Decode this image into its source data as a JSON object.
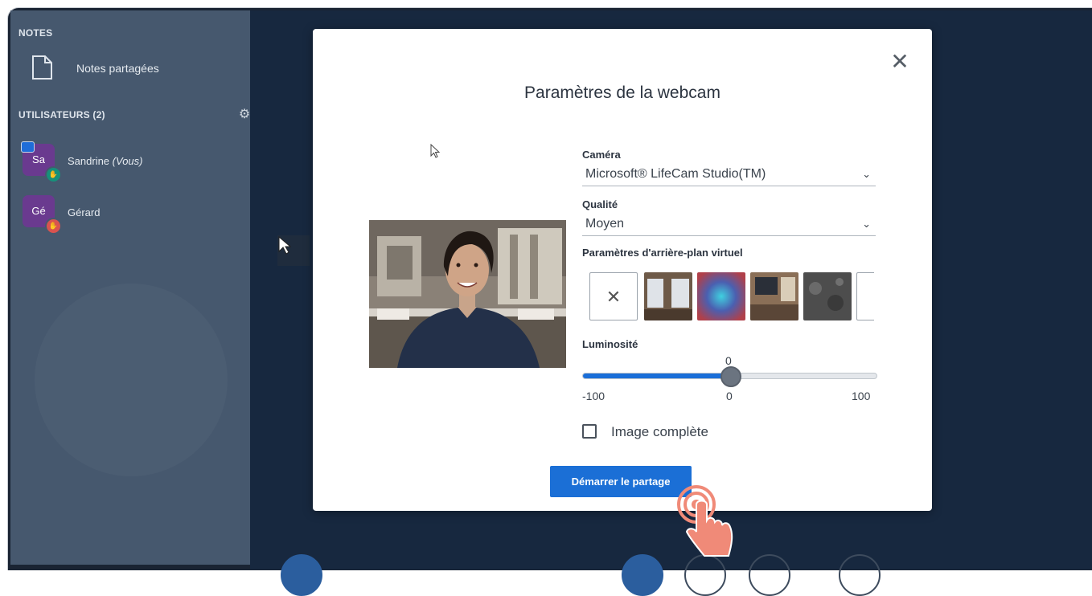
{
  "sidebar": {
    "notes_title": "NOTES",
    "shared_notes_label": "Notes partagées",
    "users_title": "UTILISATEURS (2)",
    "users": [
      {
        "initials": "Sa",
        "name": "Sandrine",
        "suffix": "(Vous)",
        "color": "#6a3a8f",
        "status_color": "#17907a"
      },
      {
        "initials": "Gé",
        "name": "Gérard",
        "suffix": "",
        "color": "#6a3a8f",
        "status_color": "#d9534f"
      }
    ]
  },
  "modal": {
    "title": "Paramètres de la webcam",
    "camera_label": "Caméra",
    "camera_value": "Microsoft® LifeCam Studio(TM)",
    "quality_label": "Qualité",
    "quality_value": "Moyen",
    "background_label": "Paramètres d'arrière-plan virtuel",
    "brightness_label": "Luminosité",
    "brightness_value": "0",
    "brightness_min": "-100",
    "brightness_mid": "0",
    "brightness_max": "100",
    "brightness_fraction": 0.5,
    "full_image_label": "Image complète",
    "full_image_checked": false,
    "start_button": "Démarrer le partage"
  },
  "colors": {
    "accent": "#1b6fd6",
    "sidebar_bg": "#46586e",
    "main_bg": "#17283f"
  }
}
